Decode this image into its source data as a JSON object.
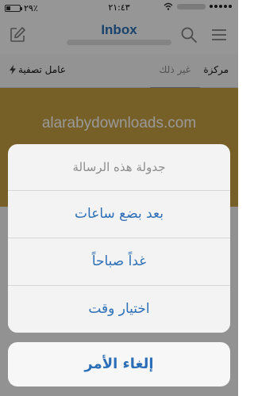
{
  "status_bar": {
    "time": "٢١:٤٣",
    "battery_percent": "٢٩٪",
    "battery_level": 0.29
  },
  "header": {
    "title": "Inbox"
  },
  "tabs": {
    "focused": "مركزة",
    "other": "غير ذلك",
    "filter": "عامل تصفية"
  },
  "banner": {
    "watermark": "alarabydownloads.com"
  },
  "action_sheet": {
    "title": "جدولة هذه الرسالة",
    "options": [
      "بعد بضع ساعات",
      "غداً صباحاً",
      "اختيار وقت"
    ],
    "cancel": "إلغاء الأمر"
  },
  "colors": {
    "accent": "#2a6fb5",
    "banner": "#c7a042"
  }
}
